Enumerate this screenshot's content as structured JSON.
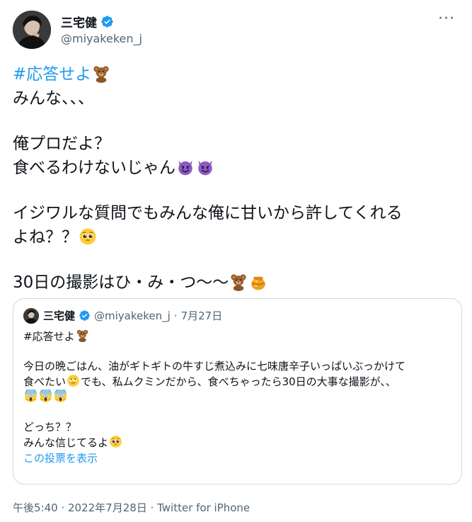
{
  "author": {
    "name": "三宅健",
    "handle": "@miyakeken_j"
  },
  "tweet": {
    "hashtag": "#応答せよ",
    "line1": "みんな、、、",
    "line2": "俺プロだよ？",
    "line3": "食べるわけないじゃん",
    "line4": "イジワルな質問でもみんな俺に甘いから許してくれる",
    "line5": "よね？？",
    "line6": "30日の撮影はひ・み・つ〜〜"
  },
  "quote": {
    "name": "三宅健",
    "handle": "@miyakeken_j",
    "sep": "·",
    "date": "7月27日",
    "hashtag": "#応答せよ",
    "line1": "今日の晩ごはん、油がギトギトの牛すじ煮込みに七味唐辛子いっぱいぶっかけて",
    "line2a": "食べたい",
    "line2b": "でも、私ムクミンだから、食べちゃったら30日の大事な撮影が、、",
    "line3": "どっち？？",
    "line4": "みんな信じてるよ",
    "poll_link": "この投票を表示"
  },
  "footer": {
    "meta": "午後5:40 · 2022年7月28日 · Twitter for iPhone"
  },
  "icons": {
    "verified": "verified-badge-icon",
    "more": "more-icon",
    "bear": "teddy-bear-emoji",
    "devil": "smiling-devil-emoji",
    "pleading": "pleading-face-emoji",
    "honey": "honey-pot-emoji",
    "rolling": "rolling-eyes-emoji",
    "scream": "screaming-face-emoji"
  },
  "colors": {
    "link": "#1d9bf0",
    "verified": "#1d9bf0",
    "secondary": "#536471",
    "text": "#0f1419"
  }
}
